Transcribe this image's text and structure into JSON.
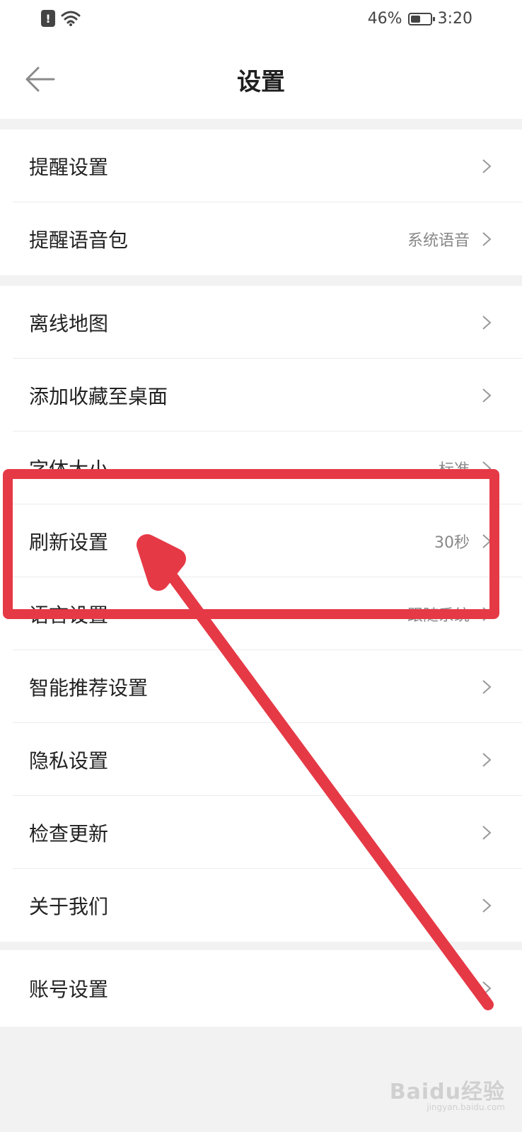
{
  "status_bar": {
    "alert_glyph": "!",
    "battery": "46%",
    "battery_level": 0.46,
    "time": "3:20"
  },
  "header": {
    "title": "设置"
  },
  "groups": [
    {
      "items": [
        {
          "label": "提醒设置",
          "value": ""
        },
        {
          "label": "提醒语音包",
          "value": "系统语音"
        }
      ]
    },
    {
      "items": [
        {
          "label": "离线地图",
          "value": ""
        },
        {
          "label": "添加收藏至桌面",
          "value": ""
        },
        {
          "label": "字体大小",
          "value": "标准"
        },
        {
          "label": "刷新设置",
          "value": "30秒"
        },
        {
          "label": "语言设置",
          "value": "跟随系统"
        },
        {
          "label": "智能推荐设置",
          "value": ""
        },
        {
          "label": "隐私设置",
          "value": ""
        },
        {
          "label": "检查更新",
          "value": ""
        },
        {
          "label": "关于我们",
          "value": ""
        }
      ]
    },
    {
      "items": [
        {
          "label": "账号设置",
          "value": ""
        }
      ]
    }
  ],
  "watermark": {
    "brand": "Baidu经验",
    "sub": "jingyan.baidu.com"
  },
  "colors": {
    "annotation": "#e63946",
    "background": "#f2f2f2",
    "text": "#222222",
    "secondary_text": "#888888"
  },
  "icons": {
    "back": "arrow-left-icon",
    "chevron": "chevron-right-icon",
    "wifi": "wifi-icon",
    "battery": "battery-icon"
  }
}
